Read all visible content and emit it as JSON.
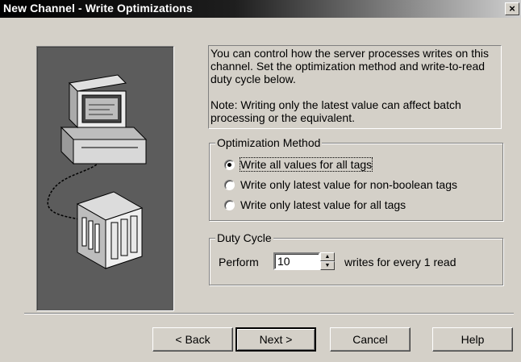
{
  "window": {
    "title": "New Channel - Write Optimizations",
    "close_glyph": "×"
  },
  "description": {
    "para1": "You can control how the server processes writes on this channel.  Set the optimization method and write-to-read duty cycle below.",
    "para2": "Note:  Writing only the latest value can affect batch processing or the equivalent."
  },
  "optimization_method": {
    "title": "Optimization Method",
    "options": [
      {
        "label": "Write all values for all tags",
        "selected": true
      },
      {
        "label": "Write only latest value for non-boolean tags",
        "selected": false
      },
      {
        "label": "Write only latest value for all tags",
        "selected": false
      }
    ]
  },
  "duty_cycle": {
    "title": "Duty Cycle",
    "perform_label": "Perform",
    "value": "10",
    "suffix": "writes for every 1 read"
  },
  "buttons": {
    "back": "< Back",
    "next": "Next >",
    "cancel": "Cancel",
    "help": "Help"
  },
  "colors": {
    "dialog_bg": "#d4d0c8",
    "illustration_bg": "#5c5c5c"
  },
  "illustration_icons": [
    "computer-icon",
    "plc-device-icon",
    "cable-icon"
  ]
}
